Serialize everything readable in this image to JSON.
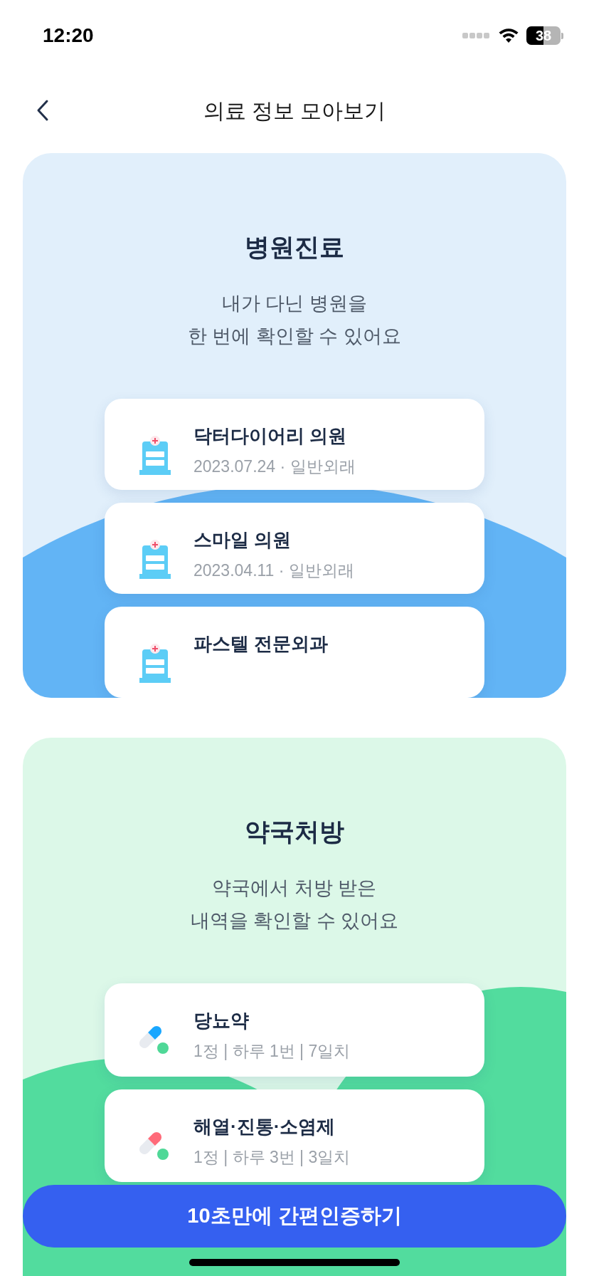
{
  "status_bar": {
    "time": "12:20",
    "battery": "38"
  },
  "header": {
    "title": "의료 정보 모아보기"
  },
  "sections": [
    {
      "kind": "hospital",
      "title": "병원진료",
      "subtitle": "내가 다닌 병원을\n한 번에 확인할 수 있어요",
      "items": [
        {
          "name": "닥터다이어리 의원",
          "detail": "2023.07.24 · 일반외래"
        },
        {
          "name": "스마일 의원",
          "detail": "2023.04.11 · 일반외래"
        },
        {
          "name": "파스텔 전문외과"
        }
      ]
    },
    {
      "kind": "pharmacy",
      "title": "약국처방",
      "subtitle": "약국에서 처방 받은\n내역을 확인할 수 있어요",
      "items": [
        {
          "name": "당뇨약",
          "detail": "1정 | 하루 1번 | 7일치",
          "color": "#1aa7ff"
        },
        {
          "name": "해열·진통·소염제",
          "detail": "1정 | 하루 3번 | 3일치",
          "color": "#ff6b7a"
        }
      ]
    }
  ],
  "button": {
    "label": "10초만에 간편인증하기"
  }
}
